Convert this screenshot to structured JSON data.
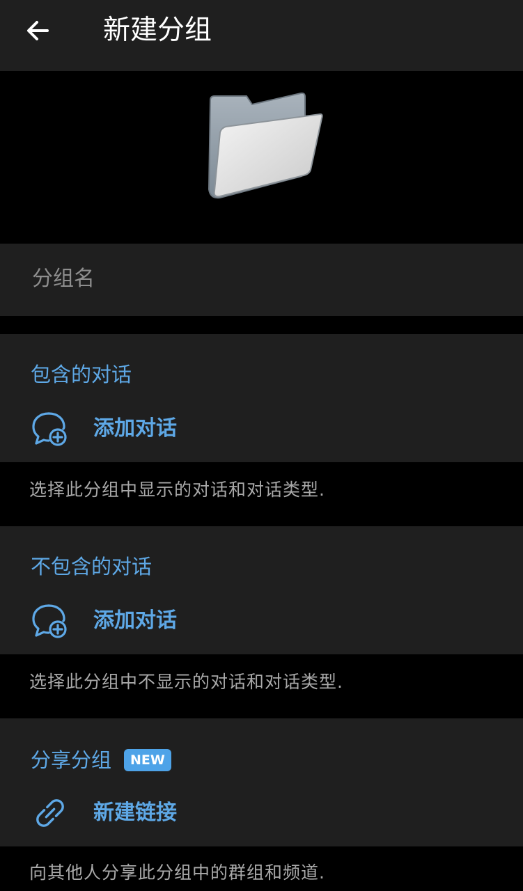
{
  "header": {
    "back_icon": "arrow-left-icon",
    "title": "新建分组"
  },
  "hero": {
    "icon": "folder-icon"
  },
  "name_field": {
    "placeholder": "分组名"
  },
  "included": {
    "title": "包含的对话",
    "action_label": "添加对话",
    "action_icon": "chat-add-icon",
    "hint": "选择此分组中显示的对话和对话类型."
  },
  "excluded": {
    "title": "不包含的对话",
    "action_label": "添加对话",
    "action_icon": "chat-add-icon",
    "hint": "选择此分组中不显示的对话和对话类型."
  },
  "share": {
    "title": "分享分组",
    "badge": "NEW",
    "action_label": "新建链接",
    "action_icon": "link-icon",
    "hint": "向其他人分享此分组中的群组和频道."
  },
  "colors": {
    "accent": "#5ea8e6",
    "badge": "#4ea3e8",
    "panel": "#1f1f1f",
    "background": "#000000"
  }
}
